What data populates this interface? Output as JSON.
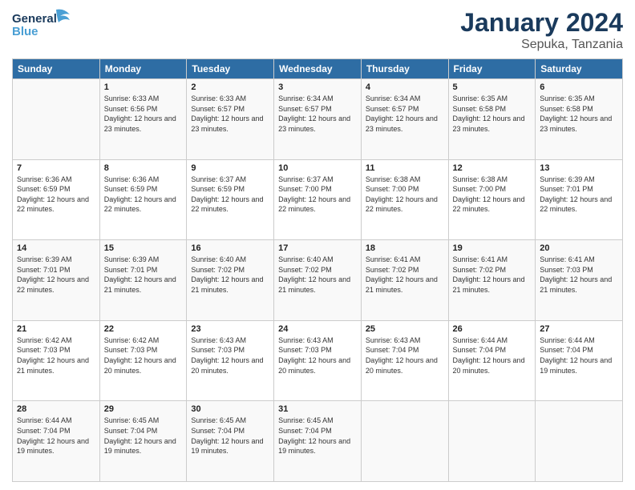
{
  "header": {
    "logo_general": "General",
    "logo_blue": "Blue",
    "main_title": "January 2024",
    "subtitle": "Sepuka, Tanzania"
  },
  "days_of_week": [
    "Sunday",
    "Monday",
    "Tuesday",
    "Wednesday",
    "Thursday",
    "Friday",
    "Saturday"
  ],
  "weeks": [
    [
      {
        "day": "",
        "sunrise": "",
        "sunset": "",
        "daylight": ""
      },
      {
        "day": "1",
        "sunrise": "Sunrise: 6:33 AM",
        "sunset": "Sunset: 6:56 PM",
        "daylight": "Daylight: 12 hours and 23 minutes."
      },
      {
        "day": "2",
        "sunrise": "Sunrise: 6:33 AM",
        "sunset": "Sunset: 6:57 PM",
        "daylight": "Daylight: 12 hours and 23 minutes."
      },
      {
        "day": "3",
        "sunrise": "Sunrise: 6:34 AM",
        "sunset": "Sunset: 6:57 PM",
        "daylight": "Daylight: 12 hours and 23 minutes."
      },
      {
        "day": "4",
        "sunrise": "Sunrise: 6:34 AM",
        "sunset": "Sunset: 6:57 PM",
        "daylight": "Daylight: 12 hours and 23 minutes."
      },
      {
        "day": "5",
        "sunrise": "Sunrise: 6:35 AM",
        "sunset": "Sunset: 6:58 PM",
        "daylight": "Daylight: 12 hours and 23 minutes."
      },
      {
        "day": "6",
        "sunrise": "Sunrise: 6:35 AM",
        "sunset": "Sunset: 6:58 PM",
        "daylight": "Daylight: 12 hours and 23 minutes."
      }
    ],
    [
      {
        "day": "7",
        "sunrise": "Sunrise: 6:36 AM",
        "sunset": "Sunset: 6:59 PM",
        "daylight": "Daylight: 12 hours and 22 minutes."
      },
      {
        "day": "8",
        "sunrise": "Sunrise: 6:36 AM",
        "sunset": "Sunset: 6:59 PM",
        "daylight": "Daylight: 12 hours and 22 minutes."
      },
      {
        "day": "9",
        "sunrise": "Sunrise: 6:37 AM",
        "sunset": "Sunset: 6:59 PM",
        "daylight": "Daylight: 12 hours and 22 minutes."
      },
      {
        "day": "10",
        "sunrise": "Sunrise: 6:37 AM",
        "sunset": "Sunset: 7:00 PM",
        "daylight": "Daylight: 12 hours and 22 minutes."
      },
      {
        "day": "11",
        "sunrise": "Sunrise: 6:38 AM",
        "sunset": "Sunset: 7:00 PM",
        "daylight": "Daylight: 12 hours and 22 minutes."
      },
      {
        "day": "12",
        "sunrise": "Sunrise: 6:38 AM",
        "sunset": "Sunset: 7:00 PM",
        "daylight": "Daylight: 12 hours and 22 minutes."
      },
      {
        "day": "13",
        "sunrise": "Sunrise: 6:39 AM",
        "sunset": "Sunset: 7:01 PM",
        "daylight": "Daylight: 12 hours and 22 minutes."
      }
    ],
    [
      {
        "day": "14",
        "sunrise": "Sunrise: 6:39 AM",
        "sunset": "Sunset: 7:01 PM",
        "daylight": "Daylight: 12 hours and 22 minutes."
      },
      {
        "day": "15",
        "sunrise": "Sunrise: 6:39 AM",
        "sunset": "Sunset: 7:01 PM",
        "daylight": "Daylight: 12 hours and 21 minutes."
      },
      {
        "day": "16",
        "sunrise": "Sunrise: 6:40 AM",
        "sunset": "Sunset: 7:02 PM",
        "daylight": "Daylight: 12 hours and 21 minutes."
      },
      {
        "day": "17",
        "sunrise": "Sunrise: 6:40 AM",
        "sunset": "Sunset: 7:02 PM",
        "daylight": "Daylight: 12 hours and 21 minutes."
      },
      {
        "day": "18",
        "sunrise": "Sunrise: 6:41 AM",
        "sunset": "Sunset: 7:02 PM",
        "daylight": "Daylight: 12 hours and 21 minutes."
      },
      {
        "day": "19",
        "sunrise": "Sunrise: 6:41 AM",
        "sunset": "Sunset: 7:02 PM",
        "daylight": "Daylight: 12 hours and 21 minutes."
      },
      {
        "day": "20",
        "sunrise": "Sunrise: 6:41 AM",
        "sunset": "Sunset: 7:03 PM",
        "daylight": "Daylight: 12 hours and 21 minutes."
      }
    ],
    [
      {
        "day": "21",
        "sunrise": "Sunrise: 6:42 AM",
        "sunset": "Sunset: 7:03 PM",
        "daylight": "Daylight: 12 hours and 21 minutes."
      },
      {
        "day": "22",
        "sunrise": "Sunrise: 6:42 AM",
        "sunset": "Sunset: 7:03 PM",
        "daylight": "Daylight: 12 hours and 20 minutes."
      },
      {
        "day": "23",
        "sunrise": "Sunrise: 6:43 AM",
        "sunset": "Sunset: 7:03 PM",
        "daylight": "Daylight: 12 hours and 20 minutes."
      },
      {
        "day": "24",
        "sunrise": "Sunrise: 6:43 AM",
        "sunset": "Sunset: 7:03 PM",
        "daylight": "Daylight: 12 hours and 20 minutes."
      },
      {
        "day": "25",
        "sunrise": "Sunrise: 6:43 AM",
        "sunset": "Sunset: 7:04 PM",
        "daylight": "Daylight: 12 hours and 20 minutes."
      },
      {
        "day": "26",
        "sunrise": "Sunrise: 6:44 AM",
        "sunset": "Sunset: 7:04 PM",
        "daylight": "Daylight: 12 hours and 20 minutes."
      },
      {
        "day": "27",
        "sunrise": "Sunrise: 6:44 AM",
        "sunset": "Sunset: 7:04 PM",
        "daylight": "Daylight: 12 hours and 19 minutes."
      }
    ],
    [
      {
        "day": "28",
        "sunrise": "Sunrise: 6:44 AM",
        "sunset": "Sunset: 7:04 PM",
        "daylight": "Daylight: 12 hours and 19 minutes."
      },
      {
        "day": "29",
        "sunrise": "Sunrise: 6:45 AM",
        "sunset": "Sunset: 7:04 PM",
        "daylight": "Daylight: 12 hours and 19 minutes."
      },
      {
        "day": "30",
        "sunrise": "Sunrise: 6:45 AM",
        "sunset": "Sunset: 7:04 PM",
        "daylight": "Daylight: 12 hours and 19 minutes."
      },
      {
        "day": "31",
        "sunrise": "Sunrise: 6:45 AM",
        "sunset": "Sunset: 7:04 PM",
        "daylight": "Daylight: 12 hours and 19 minutes."
      },
      {
        "day": "",
        "sunrise": "",
        "sunset": "",
        "daylight": ""
      },
      {
        "day": "",
        "sunrise": "",
        "sunset": "",
        "daylight": ""
      },
      {
        "day": "",
        "sunrise": "",
        "sunset": "",
        "daylight": ""
      }
    ]
  ]
}
